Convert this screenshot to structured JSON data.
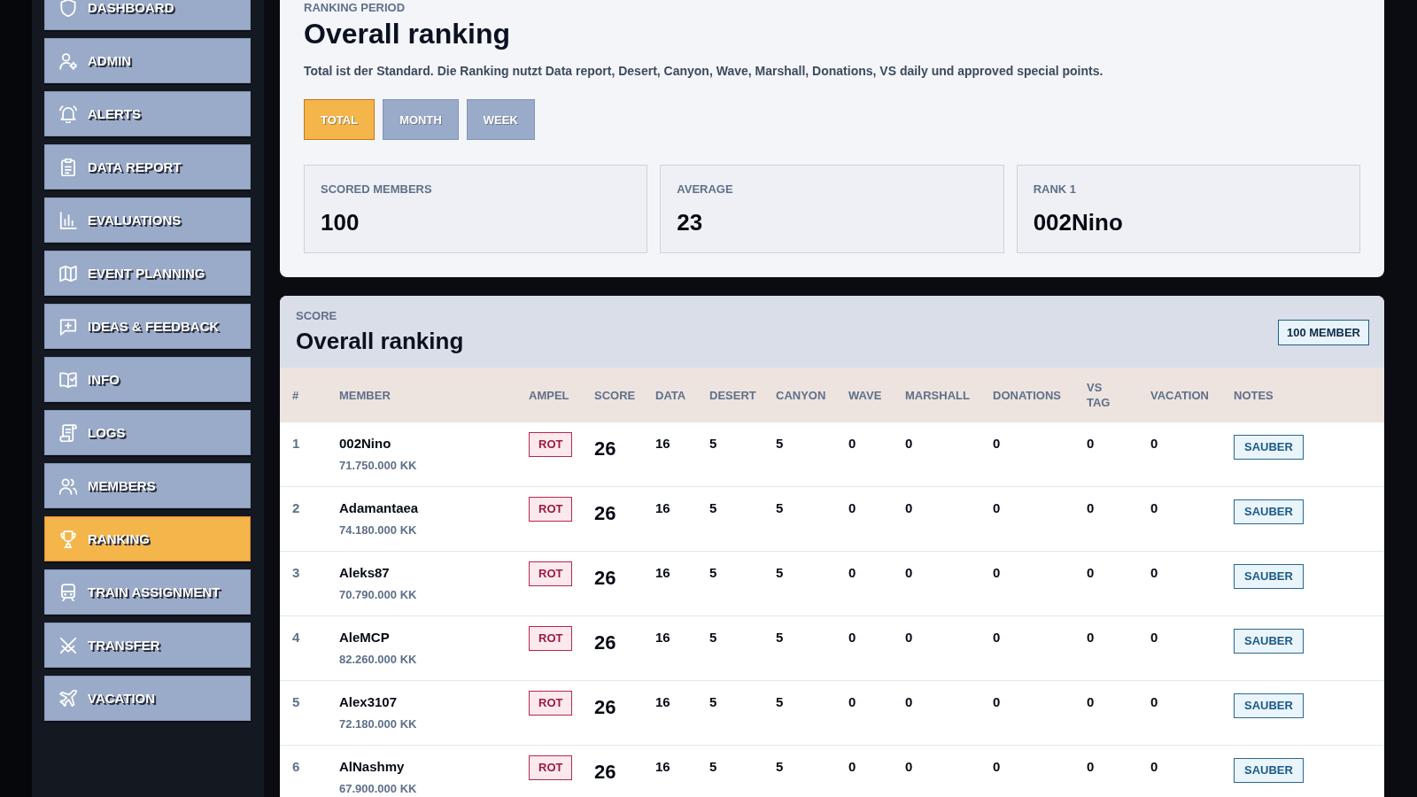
{
  "sidebar": {
    "items": [
      {
        "label": "DASHBOARD",
        "selected": false
      },
      {
        "label": "ADMIN",
        "selected": false
      },
      {
        "label": "ALERTS",
        "selected": false
      },
      {
        "label": "DATA REPORT",
        "selected": false
      },
      {
        "label": "EVALUATIONS",
        "selected": false
      },
      {
        "label": "EVENT PLANNING",
        "selected": false
      },
      {
        "label": "IDEAS & FEEDBACK",
        "selected": false
      },
      {
        "label": "INFO",
        "selected": false
      },
      {
        "label": "LOGS",
        "selected": false
      },
      {
        "label": "MEMBERS",
        "selected": false
      },
      {
        "label": "RANKING",
        "selected": true
      },
      {
        "label": "TRAIN ASSIGNMENT",
        "selected": false
      },
      {
        "label": "TRANSFER",
        "selected": false
      },
      {
        "label": "VACATION",
        "selected": false
      }
    ]
  },
  "period_panel": {
    "eyebrow": "RANKING PERIOD",
    "title": "Overall ranking",
    "description": "Total ist der Standard. Die Ranking nutzt Data report, Desert, Canyon, Wave, Marshall, Donations, VS daily und approved special points.",
    "period_tabs": [
      {
        "label": "TOTAL",
        "selected": true
      },
      {
        "label": "MONTH",
        "selected": false
      },
      {
        "label": "WEEK",
        "selected": false
      }
    ],
    "stats": [
      {
        "label": "SCORED MEMBERS",
        "value": "100"
      },
      {
        "label": "AVERAGE",
        "value": "23"
      },
      {
        "label": "RANK 1",
        "value": "002Nino"
      }
    ]
  },
  "ranking_panel": {
    "eyebrow": "SCORE",
    "title": "Overall ranking",
    "badge": "100 MEMBER",
    "table": {
      "columns": [
        "#",
        "MEMBER",
        "AMPEL",
        "SCORE",
        "DATA",
        "DESERT",
        "CANYON",
        "WAVE",
        "MARSHALL",
        "DONATIONS",
        "VS TAG",
        "VACATION",
        "NOTES"
      ],
      "rows": [
        {
          "rank": "1",
          "member": "002Nino",
          "amount": "71.750.000 KK",
          "ampel": "ROT",
          "score": "26",
          "data": "16",
          "desert": "5",
          "canyon": "5",
          "wave": "0",
          "marshall": "0",
          "donations": "0",
          "vs_tag": "0",
          "vacation": "0",
          "notes": "SAUBER"
        },
        {
          "rank": "2",
          "member": "Adamantaea",
          "amount": "74.180.000 KK",
          "ampel": "ROT",
          "score": "26",
          "data": "16",
          "desert": "5",
          "canyon": "5",
          "wave": "0",
          "marshall": "0",
          "donations": "0",
          "vs_tag": "0",
          "vacation": "0",
          "notes": "SAUBER"
        },
        {
          "rank": "3",
          "member": "Aleks87",
          "amount": "70.790.000 KK",
          "ampel": "ROT",
          "score": "26",
          "data": "16",
          "desert": "5",
          "canyon": "5",
          "wave": "0",
          "marshall": "0",
          "donations": "0",
          "vs_tag": "0",
          "vacation": "0",
          "notes": "SAUBER"
        },
        {
          "rank": "4",
          "member": "AleMCP",
          "amount": "82.260.000 KK",
          "ampel": "ROT",
          "score": "26",
          "data": "16",
          "desert": "5",
          "canyon": "5",
          "wave": "0",
          "marshall": "0",
          "donations": "0",
          "vs_tag": "0",
          "vacation": "0",
          "notes": "SAUBER"
        },
        {
          "rank": "5",
          "member": "Alex3107",
          "amount": "72.180.000 KK",
          "ampel": "ROT",
          "score": "26",
          "data": "16",
          "desert": "5",
          "canyon": "5",
          "wave": "0",
          "marshall": "0",
          "donations": "0",
          "vs_tag": "0",
          "vacation": "0",
          "notes": "SAUBER"
        },
        {
          "rank": "6",
          "member": "AlNashmy",
          "amount": "67.900.000 KK",
          "ampel": "ROT",
          "score": "26",
          "data": "16",
          "desert": "5",
          "canyon": "5",
          "wave": "0",
          "marshall": "0",
          "donations": "0",
          "vs_tag": "0",
          "vacation": "0",
          "notes": "SAUBER"
        }
      ]
    }
  }
}
